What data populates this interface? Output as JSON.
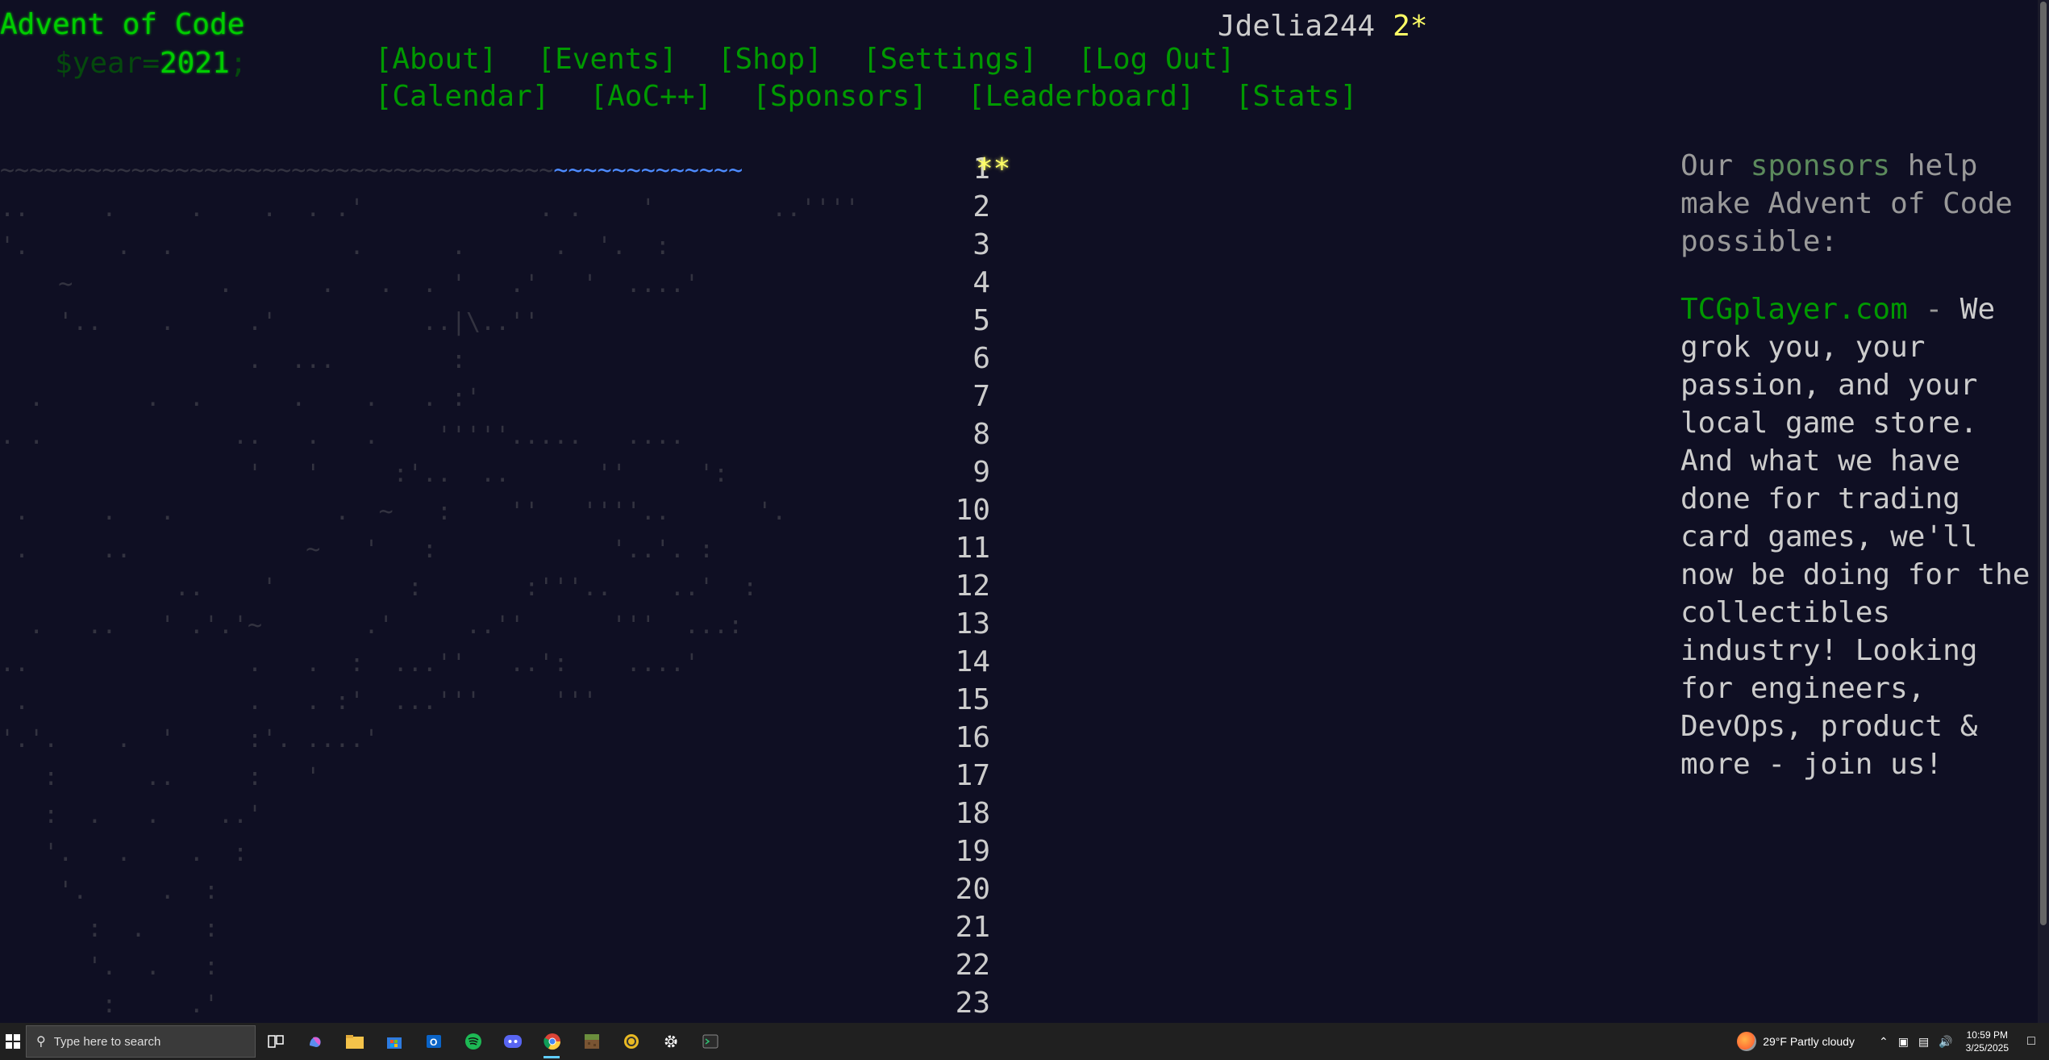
{
  "header": {
    "site_title": "Advent of Code",
    "year_prefix": "$year=",
    "year": "2021",
    "year_suffix": ";",
    "nav_row1": [
      "[About]",
      "[Events]",
      "[Shop]",
      "[Settings]",
      "[Log Out]"
    ],
    "nav_row2": [
      "[Calendar]",
      "[AoC++]",
      "[Sponsors]",
      "[Leaderboard]",
      "[Stats]"
    ],
    "username": "Jdelia244",
    "star_count": "2*"
  },
  "calendar": {
    "art_lines": [
      "~~~~~~~~~~~~~~~~~~~~~~~~~~~~~~~~~~~~~~~~~~~~~~~~~~~",
      "..     .     .    .  . .'            . .    '        ..''''",
      "'.      .  .            .      .      .  '.  :",
      "    ~          .      .   .  . '   .'   '  ....'",
      "    '..    .     .'          ..|\\..''",
      "                 .  ...        :",
      "  .       .  .      .    .   . :'",
      ". .             ..   .   .    '''''.....   ....",
      "                 '   '     :'..  ..      ''     ':",
      " .     .   .           .  ~   :    ''   ''''..      '.",
      " .     ..            ~   '   :            '..'. :",
      "            ..    '         :       :'''..    ..'  :",
      "  .   ..   ' .'.'~       .'     ..''      '''  ...:",
      "..               .   .  :  ...''   ..':    ....'",
      " .               .   . :'  ...'''     '''",
      "'.'.    .  '     :'. ....'",
      "   :      ..     :   '",
      "   :  .   .    ..'",
      "   '.   .    .  :",
      "    '.     .  :",
      "      :  .    :",
      "      '.  .   :",
      "       :     .'"
    ],
    "days": [
      "1",
      "2",
      "3",
      "4",
      "5",
      "6",
      "7",
      "8",
      "9",
      "10",
      "11",
      "12",
      "13",
      "14",
      "15",
      "16",
      "17",
      "18",
      "19",
      "20",
      "21",
      "22",
      "23"
    ],
    "day1_stars": "**"
  },
  "sponsor": {
    "intro_before": "Our ",
    "intro_link": "sponsors",
    "intro_after": " help make Advent of Code possible:",
    "sponsor_name": "TCGplayer.com",
    "sponsor_dash": " - ",
    "sponsor_text": "We grok you, your passion, and your local game store. And what we have done for trading card games, we'll now be doing for the collectibles industry! Looking for engineers, DevOps, product & more - join us!"
  },
  "taskbar": {
    "search_placeholder": "Type here to search",
    "weather": "29°F  Partly cloudy",
    "time": "10:59 PM",
    "date": "3/25/2025",
    "pinned_icons": [
      "task-view-icon",
      "copilot-icon",
      "file-explorer-icon",
      "store-icon",
      "outlook-icon",
      "spotify-icon",
      "discord-icon",
      "chrome-icon",
      "minecraft-icon",
      "app-icon",
      "settings-icon",
      "terminal-icon"
    ]
  }
}
